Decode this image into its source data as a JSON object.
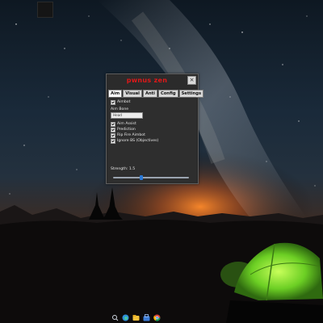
{
  "window": {
    "title": "pwnus zen",
    "close_glyph": "×"
  },
  "tabs": [
    "Aim",
    "Visual",
    "Anti",
    "Config",
    "Settings"
  ],
  "active_tab": "Aim",
  "aim": {
    "aimbot_label": "Aimbot",
    "aimbot_checked": true,
    "aim_bone_label": "Aim Bone",
    "aim_bone_value": "Head",
    "aim_assist_label": "Aim Assist",
    "aim_assist_checked": true,
    "prediction_label": "Prediction",
    "prediction_checked": true,
    "rip_fire_label": "Rip Fire Aimbot",
    "rip_fire_checked": true,
    "ignore_label": "Ignore BS (Objectives)",
    "ignore_checked": true,
    "strength_label": "Strength: 1.5",
    "strength_fraction": 0.37
  },
  "taskbar_icons": [
    "spotlight-icon",
    "edge-browser-icon",
    "file-explorer-icon",
    "store-icon",
    "chrome-icon"
  ],
  "colors": {
    "title_red": "#e01818",
    "window_bg": "#2b2b2b",
    "slider_accent": "#2a78d4",
    "tent_green": "#7cd430"
  }
}
